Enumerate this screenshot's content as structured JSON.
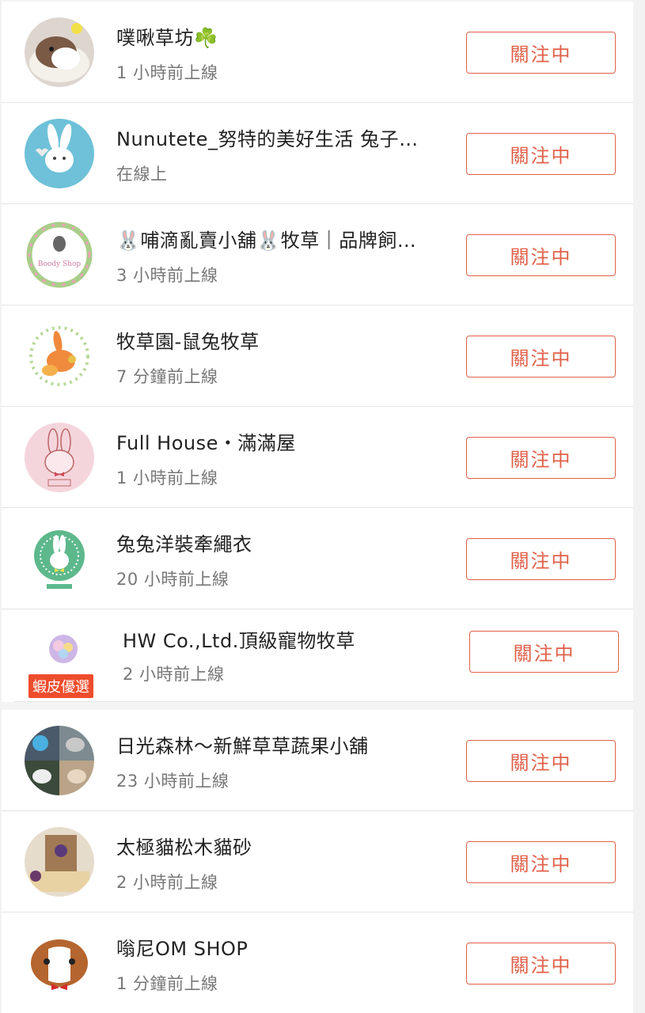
{
  "follow_label": "關注中",
  "shops": [
    {
      "name": "噗啾草坊",
      "suffix": "☘️",
      "status": "1 小時前上線",
      "avatar_icon": "guinea-pig-photo"
    },
    {
      "name": "Nunutete_努特的美好生活 兔子…",
      "status": "在線上",
      "avatar_icon": "white-rabbit-logo"
    },
    {
      "name": "🐰哺滴亂賣小舖🐰牧草｜品牌飼…",
      "status": "3 小時前上線",
      "avatar_icon": "boody-shop-wreath-logo",
      "avatar_text": "Boody Shop"
    },
    {
      "name": "牧草園-鼠兔牧草",
      "status": "7 分鐘前上線",
      "avatar_icon": "orange-rabbit-logo"
    },
    {
      "name": "Full House・滿滿屋",
      "status": "1 小時前上線",
      "avatar_icon": "pink-rabbit-logo"
    },
    {
      "name": "兔兔洋裝牽繩衣",
      "status": "20 小時前上線",
      "avatar_icon": "green-rabbit-badge-logo"
    },
    {
      "name": "HW Co.,Ltd.頂級寵物牧草",
      "status": "2 小時前上線",
      "avatar_icon": "hw-logo",
      "badge": "蝦皮優選"
    },
    {
      "name": "日光森林～新鮮草草蔬果小舖",
      "status": "23 小時前上線",
      "avatar_icon": "rabbit-collage-photo"
    },
    {
      "name": "太極貓松木貓砂",
      "status": "2 小時前上線",
      "avatar_icon": "cat-litter-photo"
    },
    {
      "name": "嗡尼OM SHOP",
      "status": "1 分鐘前上線",
      "avatar_icon": "guinea-pig-cartoon-logo"
    }
  ],
  "colors": {
    "accent": "#e0614a",
    "text": "#222222",
    "muted": "#777777",
    "badge": "#ee4d2d"
  }
}
